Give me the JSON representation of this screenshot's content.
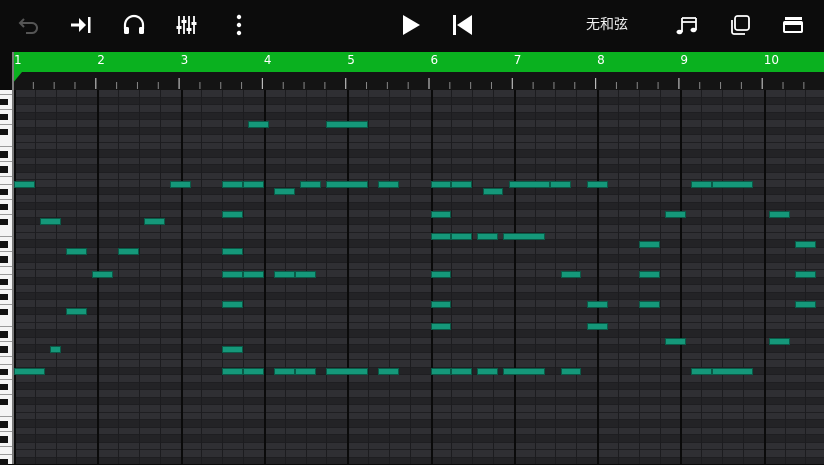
{
  "toolbar": {
    "icons": [
      "undo-icon",
      "go-to-end-icon",
      "headphones-icon",
      "mixer-icon",
      "more-vertical-icon",
      "play-icon",
      "rewind-to-start-icon",
      "note-icon",
      "duplicate-icon",
      "window-icon"
    ],
    "chord_label": "无和弦"
  },
  "ruler": {
    "bar_numbers": [
      "1",
      "2",
      "3",
      "4",
      "5",
      "6",
      "7",
      "8",
      "9",
      "10"
    ],
    "accent_color": "#0ab11f"
  },
  "colors": {
    "note_fill": "#15987a",
    "note_border": "#0a5a47",
    "grid_light": "#2f2f33",
    "grid_dark": "#232326"
  }
}
